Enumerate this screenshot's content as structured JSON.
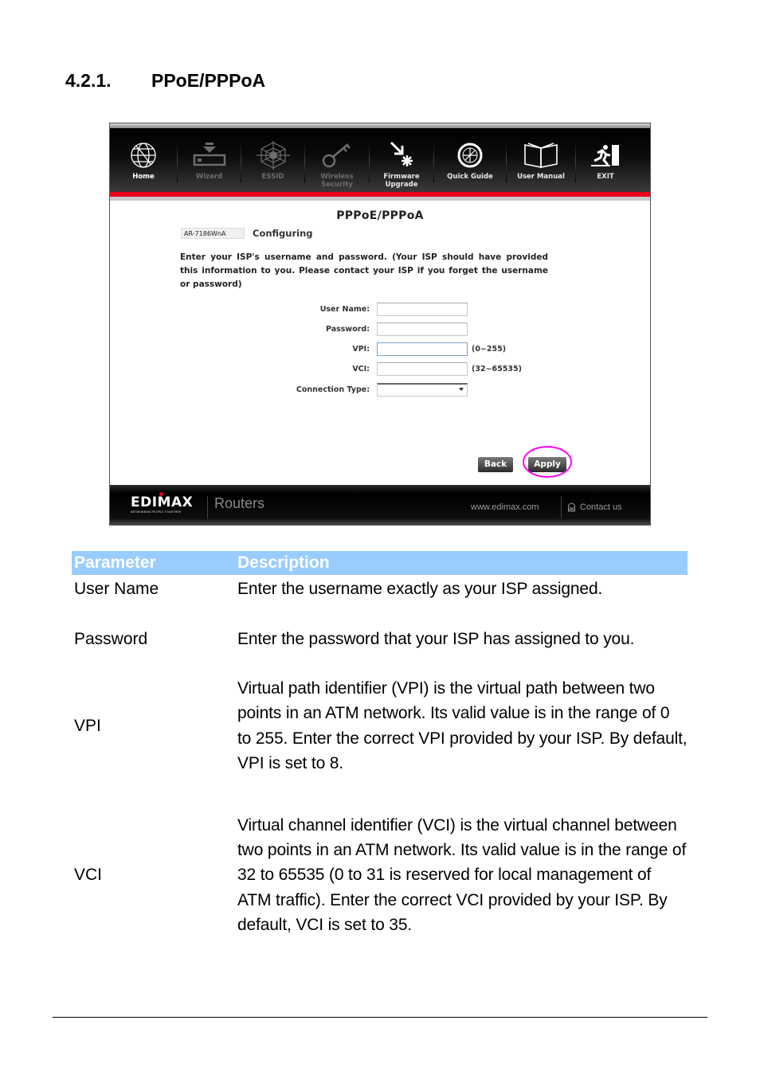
{
  "section": {
    "number": "4.2.1.",
    "title": "PPoE/PPPoA"
  },
  "router_ui": {
    "nav": [
      {
        "label": "Home",
        "icon": "globe-icon",
        "state": "active"
      },
      {
        "label": "Wizard",
        "icon": "download-drive-icon",
        "state": "disabled"
      },
      {
        "label": "ESSID",
        "icon": "spiderweb-icon",
        "state": "disabled"
      },
      {
        "label_line1": "Wireless",
        "label_line2": "Security",
        "icon": "key-icon",
        "state": "disabled"
      },
      {
        "label_line1": "Firmware",
        "label_line2": "Upgrade",
        "icon": "firmware-arrow-icon",
        "state": "enabled"
      },
      {
        "label": "Quick Guide",
        "icon": "compass-icon",
        "state": "enabled"
      },
      {
        "label": "User Manual",
        "icon": "open-book-icon",
        "state": "enabled"
      },
      {
        "label": "EXIT",
        "icon": "running-exit-icon",
        "state": "enabled"
      }
    ],
    "page_title": "PPPoE/PPPoA",
    "model": "AR-7186WnA",
    "configuring_label": "Configuring",
    "intro_text": "Enter your ISP's username and password. (Your ISP should have provided this information to you. Please contact your ISP if you forget the username or password)",
    "form": {
      "user_name": {
        "label": "User Name:",
        "value": ""
      },
      "password": {
        "label": "Password:",
        "value": ""
      },
      "vpi": {
        "label": "VPI:",
        "value": "",
        "hint": "(0~255)"
      },
      "vci": {
        "label": "VCI:",
        "value": "",
        "hint": "(32~65535)"
      },
      "connection_type": {
        "label": "Connection Type:",
        "selected": ""
      }
    },
    "buttons": {
      "back": "Back",
      "apply": "Apply"
    },
    "footer": {
      "logo": "EDIMAX",
      "tagline": "NETWORKING PEOPLE TOGETHER",
      "product": "Routers",
      "website": "www.edimax.com",
      "contact": "Contact us"
    },
    "colors": {
      "accent_red": "#e8001c",
      "highlight": "#ff00ff"
    }
  },
  "table": {
    "headers": {
      "parameter": "Parameter",
      "description": "Description"
    },
    "header_color": "#99ccff",
    "rows": [
      {
        "parameter": "User Name",
        "description": "Enter the username exactly as your ISP assigned."
      },
      {
        "parameter": "Password",
        "description": "Enter the password that your ISP has assigned to you."
      },
      {
        "parameter": "VPI",
        "description": "Virtual path identifier (VPI) is the virtual path between two points in an ATM network. Its valid value is in the range of 0 to 255. Enter the correct VPI provided by your ISP. By default, VPI is set to 8."
      },
      {
        "parameter": "VCI",
        "description": "Virtual channel identifier (VCI) is the virtual channel between two points in an ATM network. Its valid value is in the range of 32 to 65535 (0 to 31 is reserved for local management of ATM traffic). Enter the correct VCI provided by your ISP. By default, VCI is set to 35."
      }
    ]
  }
}
